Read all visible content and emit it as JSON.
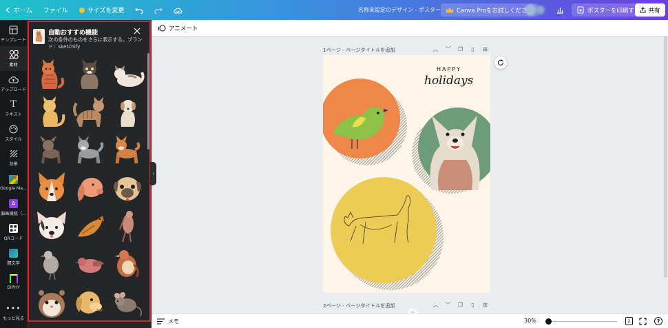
{
  "topbar": {
    "home": "ホーム",
    "file": "ファイル",
    "resize": "サイズを変更",
    "doc_title": "名称未設定のデザイン - ポスター",
    "pro": "Canva Proをお試しください",
    "print": "ポスターを印刷する",
    "share": "共有"
  },
  "rail": [
    {
      "label": "テンプレート",
      "icon": "template-icon"
    },
    {
      "label": "素材",
      "icon": "elements-icon"
    },
    {
      "label": "アップロード",
      "icon": "upload-icon"
    },
    {
      "label": "テキスト",
      "icon": "text-icon"
    },
    {
      "label": "スタイル",
      "icon": "style-icon"
    },
    {
      "label": "背景",
      "icon": "background-icon"
    },
    {
      "label": "Google Ma...",
      "icon": "google-maps-icon"
    },
    {
      "label": "脳画機能（...",
      "icon": "app-icon"
    },
    {
      "label": "QRコード",
      "icon": "qr-icon"
    },
    {
      "label": "題文字",
      "icon": "image-icon"
    },
    {
      "label": "GIPHY",
      "icon": "giphy-icon"
    },
    {
      "label": "もっと見る",
      "icon": "more-icon"
    }
  ],
  "panel": {
    "title": "自動おすすめ機能",
    "desc": "次の条件のものをさらに表示する。ブランド：sketchify"
  },
  "toolbar": {
    "animate": "アニメート"
  },
  "pages": [
    {
      "label": "1ページ - ページタイトルを追加"
    },
    {
      "label": "2ページ - ページタイトルを追加"
    }
  ],
  "poster": {
    "happy": "HAPPY",
    "holidays": "holidays"
  },
  "bottom": {
    "memo": "メモ",
    "zoom": "30%",
    "pages": "2",
    "help": "?"
  },
  "colors": {
    "accent": "#7d2ae8",
    "orange": "#f0874a",
    "green": "#6f9c78",
    "yellow": "#eccc55",
    "cream": "#fdf5e7"
  }
}
